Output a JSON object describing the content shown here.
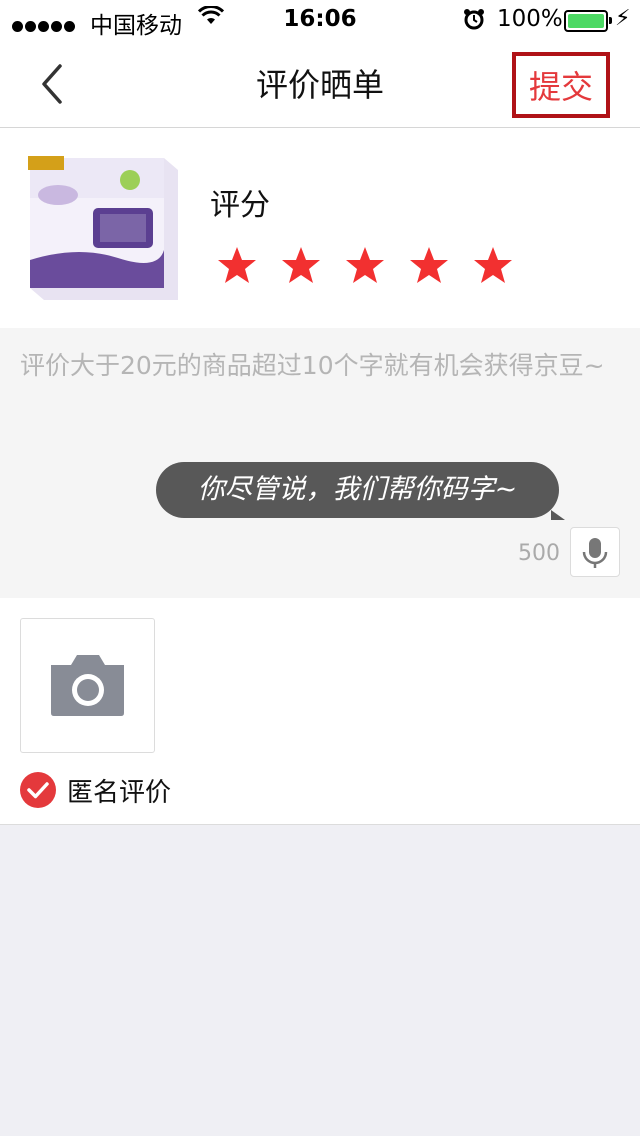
{
  "status_bar": {
    "carrier": "中国移动",
    "time": "16:06",
    "battery": "100%",
    "battery_color": "#4cd964",
    "icons": [
      "signal-dots-icon",
      "wifi-icon",
      "alarm-icon",
      "battery-icon",
      "charging-bolt-icon"
    ]
  },
  "nav": {
    "title": "评价晒单",
    "submit_label": "提交",
    "back_icon": "chevron-left-icon"
  },
  "product": {
    "rating_label": "评分",
    "rating": 5,
    "max_rating": 5,
    "star_color": "#f23030"
  },
  "comment": {
    "placeholder": "评价大于20元的商品超过10个字就有机会获得京豆~",
    "value": "",
    "bubble_text": "你尽管说，我们帮你码字~",
    "char_count": "500",
    "mic_icon": "microphone-icon"
  },
  "photos": {
    "add_icon": "camera-icon",
    "anonymous_label": "匿名评价",
    "anonymous_checked": true
  },
  "colors": {
    "accent": "#e4393c",
    "highlight_border": "#b01217",
    "page_bg": "#efeff4"
  }
}
